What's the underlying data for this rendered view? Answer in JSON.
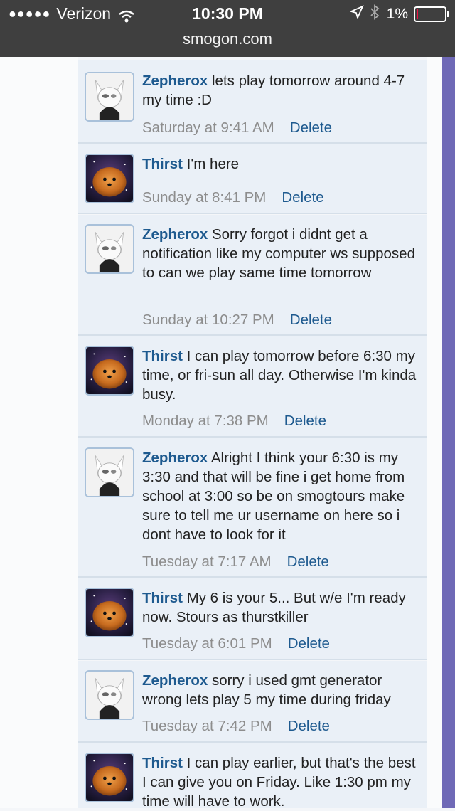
{
  "status_bar": {
    "carrier": "Verizon",
    "time": "10:30 PM",
    "battery": "1%",
    "url": "smogon.com"
  },
  "posts": [
    {
      "user": "Zepherox",
      "text": "lets play tomorrow around 4-7 my time :D",
      "when": "Saturday at 9:41 AM",
      "action": "Delete",
      "avatar": "cat-avatar-icon"
    },
    {
      "user": "Thirst",
      "text": "I'm here",
      "when": "Sunday at 8:41 PM",
      "action": "Delete",
      "avatar": "dog-avatar-icon"
    },
    {
      "user": "Zepherox",
      "text": "Sorry forgot i didnt get a notification like my computer ws supposed to can we play same time tomorrow",
      "when": "Sunday at 10:27 PM",
      "action": "Delete",
      "avatar": "cat-avatar-icon"
    },
    {
      "user": "Thirst",
      "text": "I can play tomorrow before 6:30 my time, or fri-sun all day. Otherwise I'm kinda busy.",
      "when": "Monday at 7:38 PM",
      "action": "Delete",
      "avatar": "dog-avatar-icon"
    },
    {
      "user": "Zepherox",
      "text": "Alright I think your 6:30 is my 3:30 and that will be fine i get home from school at 3:00 so be on smogtours make sure to tell me ur username on here so i dont have to look for it",
      "when": "Tuesday at 7:17 AM",
      "action": "Delete",
      "avatar": "cat-avatar-icon"
    },
    {
      "user": "Thirst",
      "text": "My 6 is your 5... But w/e I'm ready now. Stours as thurstkiller",
      "when": "Tuesday at 6:01 PM",
      "action": "Delete",
      "avatar": "dog-avatar-icon"
    },
    {
      "user": "Zepherox",
      "text": "sorry i used gmt generator wrong lets play 5 my time during friday",
      "when": "Tuesday at 7:42 PM",
      "action": "Delete",
      "avatar": "cat-avatar-icon"
    },
    {
      "user": "Thirst",
      "text": "I can play earlier, but that's the best I can give you on Friday. Like 1:30 pm my time will have to work.",
      "when": "",
      "action": "",
      "avatar": "dog-avatar-icon"
    }
  ]
}
